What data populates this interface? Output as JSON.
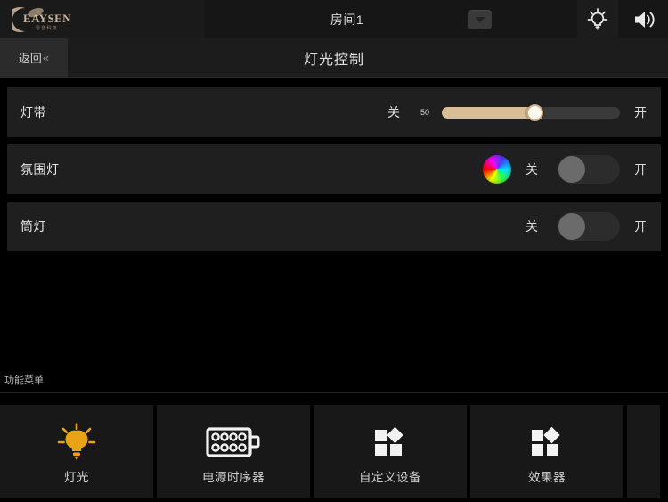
{
  "topbar": {
    "logo_text": "EAYSEN",
    "logo_sub": "恩音科技",
    "room_title": "房间1",
    "dropdown_icon": "chevron-down-icon",
    "icons": [
      {
        "name": "light-bulb-icon",
        "label": ""
      },
      {
        "name": "speaker-volume-icon",
        "label": ""
      }
    ]
  },
  "navbar": {
    "back_label": "返回",
    "back_chevron": "«",
    "title": "灯光控制"
  },
  "devices": [
    {
      "name": "灯带",
      "type": "slider",
      "off_label": "关",
      "on_label": "开",
      "value": "50",
      "value_percent": 52,
      "fill_color": "#d9bd97"
    },
    {
      "name": "氛围灯",
      "type": "toggle",
      "off_label": "关",
      "on_label": "开",
      "state": "off",
      "has_color_wheel": true,
      "color_wheel_icon": "color-wheel-icon"
    },
    {
      "name": "筒灯",
      "type": "toggle",
      "off_label": "关",
      "on_label": "开",
      "state": "off",
      "has_color_wheel": false
    }
  ],
  "function_menu": {
    "label": "功能菜单",
    "tiles": [
      {
        "label": "灯光",
        "icon": "light-bulb-icon",
        "active": true,
        "accent": "#e8a317"
      },
      {
        "label": "电源时序器",
        "icon": "power-sequencer-icon",
        "active": false,
        "accent": "#ffffff"
      },
      {
        "label": "自定义设备",
        "icon": "custom-device-icon",
        "active": false,
        "accent": "#ffffff"
      },
      {
        "label": "效果器",
        "icon": "effects-icon",
        "active": false,
        "accent": "#ffffff"
      }
    ]
  },
  "colors": {
    "background": "#000000",
    "row_background": "#1f1f1f",
    "topbar_background": "#161616",
    "navbar_background": "#1c1c1c",
    "accent_amber": "#e8a317",
    "slider_fill": "#d9bd97",
    "text_primary": "#e6e6e6",
    "text_secondary": "#b9b9b9"
  }
}
